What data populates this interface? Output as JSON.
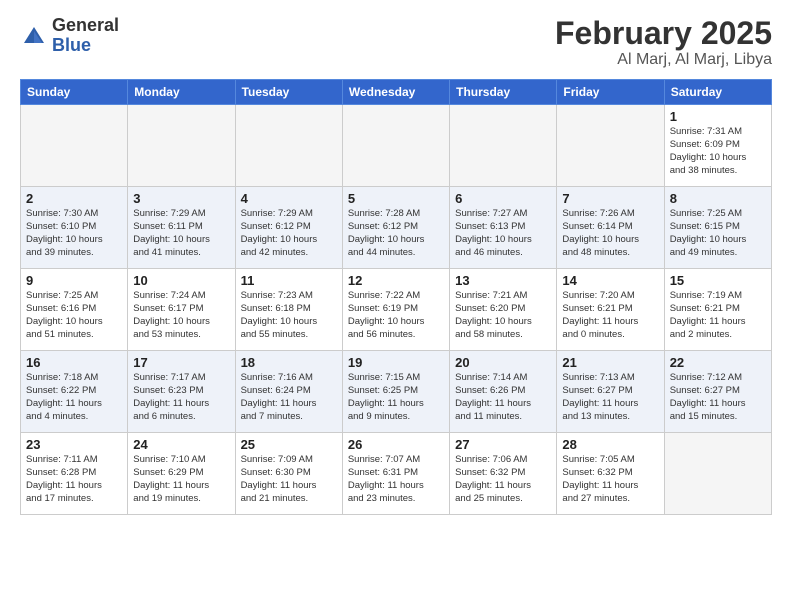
{
  "header": {
    "logo_general": "General",
    "logo_blue": "Blue",
    "month_title": "February 2025",
    "location": "Al Marj, Al Marj, Libya"
  },
  "weekdays": [
    "Sunday",
    "Monday",
    "Tuesday",
    "Wednesday",
    "Thursday",
    "Friday",
    "Saturday"
  ],
  "weeks": [
    [
      {
        "day": "",
        "info": ""
      },
      {
        "day": "",
        "info": ""
      },
      {
        "day": "",
        "info": ""
      },
      {
        "day": "",
        "info": ""
      },
      {
        "day": "",
        "info": ""
      },
      {
        "day": "",
        "info": ""
      },
      {
        "day": "1",
        "info": "Sunrise: 7:31 AM\nSunset: 6:09 PM\nDaylight: 10 hours\nand 38 minutes."
      }
    ],
    [
      {
        "day": "2",
        "info": "Sunrise: 7:30 AM\nSunset: 6:10 PM\nDaylight: 10 hours\nand 39 minutes."
      },
      {
        "day": "3",
        "info": "Sunrise: 7:29 AM\nSunset: 6:11 PM\nDaylight: 10 hours\nand 41 minutes."
      },
      {
        "day": "4",
        "info": "Sunrise: 7:29 AM\nSunset: 6:12 PM\nDaylight: 10 hours\nand 42 minutes."
      },
      {
        "day": "5",
        "info": "Sunrise: 7:28 AM\nSunset: 6:12 PM\nDaylight: 10 hours\nand 44 minutes."
      },
      {
        "day": "6",
        "info": "Sunrise: 7:27 AM\nSunset: 6:13 PM\nDaylight: 10 hours\nand 46 minutes."
      },
      {
        "day": "7",
        "info": "Sunrise: 7:26 AM\nSunset: 6:14 PM\nDaylight: 10 hours\nand 48 minutes."
      },
      {
        "day": "8",
        "info": "Sunrise: 7:25 AM\nSunset: 6:15 PM\nDaylight: 10 hours\nand 49 minutes."
      }
    ],
    [
      {
        "day": "9",
        "info": "Sunrise: 7:25 AM\nSunset: 6:16 PM\nDaylight: 10 hours\nand 51 minutes."
      },
      {
        "day": "10",
        "info": "Sunrise: 7:24 AM\nSunset: 6:17 PM\nDaylight: 10 hours\nand 53 minutes."
      },
      {
        "day": "11",
        "info": "Sunrise: 7:23 AM\nSunset: 6:18 PM\nDaylight: 10 hours\nand 55 minutes."
      },
      {
        "day": "12",
        "info": "Sunrise: 7:22 AM\nSunset: 6:19 PM\nDaylight: 10 hours\nand 56 minutes."
      },
      {
        "day": "13",
        "info": "Sunrise: 7:21 AM\nSunset: 6:20 PM\nDaylight: 10 hours\nand 58 minutes."
      },
      {
        "day": "14",
        "info": "Sunrise: 7:20 AM\nSunset: 6:21 PM\nDaylight: 11 hours\nand 0 minutes."
      },
      {
        "day": "15",
        "info": "Sunrise: 7:19 AM\nSunset: 6:21 PM\nDaylight: 11 hours\nand 2 minutes."
      }
    ],
    [
      {
        "day": "16",
        "info": "Sunrise: 7:18 AM\nSunset: 6:22 PM\nDaylight: 11 hours\nand 4 minutes."
      },
      {
        "day": "17",
        "info": "Sunrise: 7:17 AM\nSunset: 6:23 PM\nDaylight: 11 hours\nand 6 minutes."
      },
      {
        "day": "18",
        "info": "Sunrise: 7:16 AM\nSunset: 6:24 PM\nDaylight: 11 hours\nand 7 minutes."
      },
      {
        "day": "19",
        "info": "Sunrise: 7:15 AM\nSunset: 6:25 PM\nDaylight: 11 hours\nand 9 minutes."
      },
      {
        "day": "20",
        "info": "Sunrise: 7:14 AM\nSunset: 6:26 PM\nDaylight: 11 hours\nand 11 minutes."
      },
      {
        "day": "21",
        "info": "Sunrise: 7:13 AM\nSunset: 6:27 PM\nDaylight: 11 hours\nand 13 minutes."
      },
      {
        "day": "22",
        "info": "Sunrise: 7:12 AM\nSunset: 6:27 PM\nDaylight: 11 hours\nand 15 minutes."
      }
    ],
    [
      {
        "day": "23",
        "info": "Sunrise: 7:11 AM\nSunset: 6:28 PM\nDaylight: 11 hours\nand 17 minutes."
      },
      {
        "day": "24",
        "info": "Sunrise: 7:10 AM\nSunset: 6:29 PM\nDaylight: 11 hours\nand 19 minutes."
      },
      {
        "day": "25",
        "info": "Sunrise: 7:09 AM\nSunset: 6:30 PM\nDaylight: 11 hours\nand 21 minutes."
      },
      {
        "day": "26",
        "info": "Sunrise: 7:07 AM\nSunset: 6:31 PM\nDaylight: 11 hours\nand 23 minutes."
      },
      {
        "day": "27",
        "info": "Sunrise: 7:06 AM\nSunset: 6:32 PM\nDaylight: 11 hours\nand 25 minutes."
      },
      {
        "day": "28",
        "info": "Sunrise: 7:05 AM\nSunset: 6:32 PM\nDaylight: 11 hours\nand 27 minutes."
      },
      {
        "day": "",
        "info": ""
      }
    ]
  ]
}
